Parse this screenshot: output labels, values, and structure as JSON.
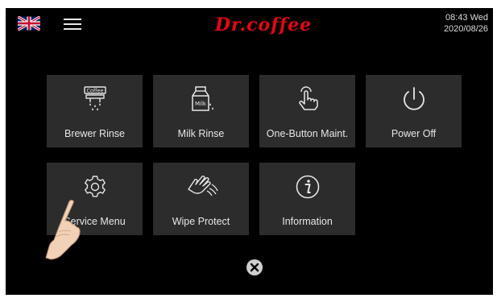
{
  "header": {
    "language_flag_icon": "uk-flag-icon",
    "menu_icon": "hamburger-menu-icon",
    "brand": "Dr.coffee",
    "time_day": "08:43 Wed",
    "date": "2020/08/26"
  },
  "tiles": [
    {
      "label": "Brewer Rinse",
      "icon": "coffee-brewer-rinse-icon"
    },
    {
      "label": "Milk Rinse",
      "icon": "milk-carton-icon"
    },
    {
      "label": "One-Button Maint.",
      "icon": "touch-hand-icon"
    },
    {
      "label": "Power Off",
      "icon": "power-icon"
    },
    {
      "label": "Service Menu",
      "icon": "gear-icon"
    },
    {
      "label": "Wipe Protect",
      "icon": "wipe-hand-icon"
    },
    {
      "label": "Information",
      "icon": "info-icon"
    }
  ],
  "close_icon": "close-circle-icon",
  "pointer_icon": "pointing-hand-icon",
  "colors": {
    "background": "#000000",
    "tile": "#2c2c2c",
    "brand": "#e30613",
    "text": "#e6e6e6"
  }
}
